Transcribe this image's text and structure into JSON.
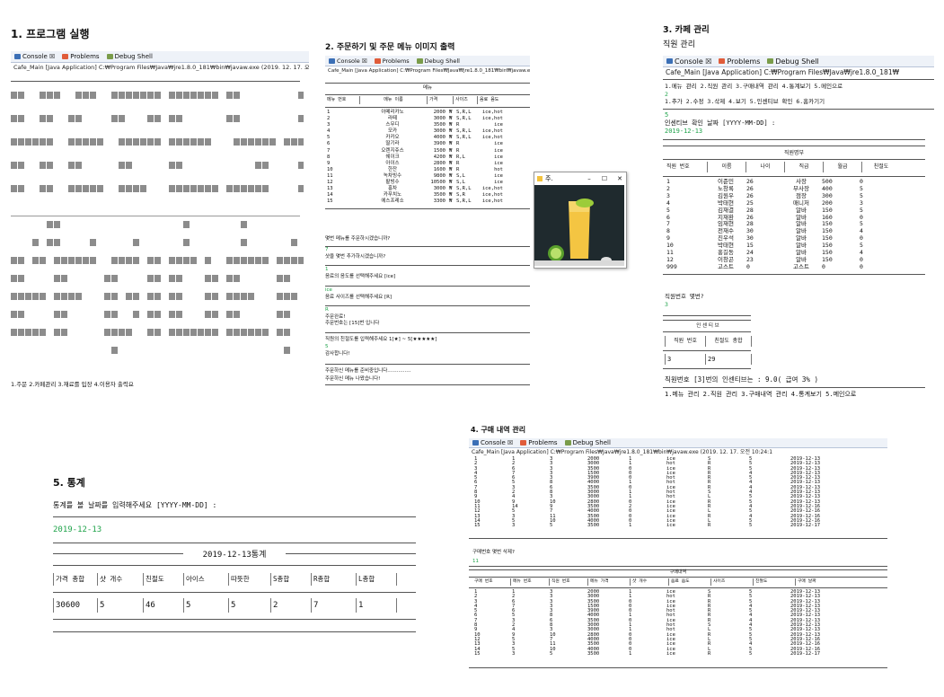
{
  "sec1": {
    "title": "1. 프로그램 실행",
    "tabs": [
      "Console ☒",
      "Problems",
      "Debug Shell"
    ],
    "cmdline": "Cafe_Main [Java Application] C:₩Program Files₩Java₩jre1.8.0_181₩bin₩javaw.exe (2019. 12. 17. 오전 10:24:11)",
    "menu": "1.주문 2.카페관리 3.재료를 입장 4.이용자 출력요"
  },
  "sec2": {
    "title": "2. 주문하기 및 주문 메뉴 이미지 출력",
    "tabs": [
      "Console ☒",
      "Problems",
      "Debug Shell"
    ],
    "cmdline": "Cafe_Main [Java Application] C:₩Program Files₩Java₩jre1.8.0_181₩bin₩javaw.exe (2019. 12. 17. 오전 10:24:11)",
    "menu_title": "메뉴",
    "headers": [
      "메뉴 번호",
      "메뉴 이름",
      "가격",
      "사이즈",
      "음료 음도"
    ],
    "rows": [
      [
        "1",
        "아메리카노",
        "2000",
        "₩",
        "S,R,L",
        "ice,hot"
      ],
      [
        "2",
        "라떼",
        "3000",
        "₩",
        "S,R,L",
        "ice,hot"
      ],
      [
        "3",
        "스무디",
        "3500",
        "₩",
        "R",
        "ice"
      ],
      [
        "4",
        "모카",
        "3000",
        "₩",
        "S,R,L",
        "ice,hot"
      ],
      [
        "5",
        "카카오",
        "4000",
        "₩",
        "S,R,L",
        "ice,hot"
      ],
      [
        "6",
        "딸기라",
        "3900",
        "₩",
        "R",
        "ice"
      ],
      [
        "7",
        "오렌지쥬스",
        "1500",
        "₩",
        "R",
        "ice"
      ],
      [
        "8",
        "쉐이크",
        "4200",
        "₩",
        "R,L",
        "ice"
      ],
      [
        "9",
        "아이스",
        "2800",
        "₩",
        "R",
        "ice"
      ],
      [
        "10",
        "한잔",
        "1600",
        "₩",
        "R",
        "hot"
      ],
      [
        "11",
        "녹차빙수",
        "9800",
        "₩",
        "S,L",
        "ice"
      ],
      [
        "12",
        "팥빙수",
        "10500",
        "₩",
        "S,L",
        "ice"
      ],
      [
        "13",
        "홍차",
        "3000",
        "₩",
        "S,R,L",
        "ice,hot"
      ],
      [
        "14",
        "카푸치노",
        "3500",
        "₩",
        "S,R",
        "ice,hot"
      ],
      [
        "15",
        "에스프레소",
        "3300",
        "₩",
        "S,R,L",
        "ice,hot"
      ]
    ],
    "q1": "몇번 메뉴를 주문하시겠습니까?",
    "a1": "7",
    "q2": "샷을 몇번 추가하시겠습니까?",
    "a2": "1",
    "q3": "음료의 음도를 선택해주세요 [ice]",
    "a3": "ice",
    "q4": "음료 사이즈를 선택해주세요 [R]",
    "a4": "R",
    "r1": "주문완료!",
    "r2": "주문번호는 [15]번 입니다",
    "q5": "직원의 친절도를 입력해주세요 1[★] ~ 5[★★★★★]",
    "a5": "5",
    "r3": "감사합니다!",
    "r4": "주문하신 메뉴를 준비중입니다...............",
    "r5": "주문하신 메뉴 나왔습니다!",
    "popup_title": "주.",
    "popup_min": "–",
    "popup_max": "☐",
    "popup_close": "✕"
  },
  "sec3": {
    "title": "3. 카페 관리",
    "subtitle": "직원 관리",
    "tabs": [
      "Console ☒",
      "Problems",
      "Debug Shell"
    ],
    "cmdline": "Cafe_Main [Java Application] C:₩Program Files₩Java₩jre1.8.0_181₩",
    "menu1": "1.메뉴 관리 2.직원 관리 3.구매내역 관리 4.통계보기 5.메인으로",
    "in1": "2",
    "menu2": "1.추가 2.수정 3.삭제 4.보기 5.인센티브 확인 6.홈카기기",
    "in2": "5",
    "ask_date": "인센티브 확인 날짜 [YYYY-MM-DD] :",
    "in_date": "2019-12-13",
    "list_title": "직원명부",
    "headers": [
      "직원 번호",
      "이름",
      "나이",
      "직급",
      "월급",
      "친절도"
    ],
    "rows": [
      [
        "1",
        "이준민",
        "26",
        "사장",
        "500",
        "0"
      ],
      [
        "2",
        "노창록",
        "26",
        "부사장",
        "400",
        "5"
      ],
      [
        "3",
        "김원우",
        "26",
        "점장",
        "300",
        "5"
      ],
      [
        "4",
        "박태현",
        "25",
        "매니저",
        "200",
        "3"
      ],
      [
        "5",
        "김재결",
        "28",
        "알바",
        "150",
        "5"
      ],
      [
        "6",
        "지재환",
        "26",
        "알바",
        "160",
        "0"
      ],
      [
        "7",
        "임재현",
        "28",
        "알바",
        "150",
        "5"
      ],
      [
        "8",
        "전재수",
        "30",
        "알바",
        "150",
        "4"
      ],
      [
        "9",
        "진우석",
        "30",
        "알바",
        "150",
        "0"
      ],
      [
        "10",
        "박태현",
        "15",
        "알바",
        "150",
        "5"
      ],
      [
        "11",
        "홍길동",
        "24",
        "알바",
        "150",
        "4"
      ],
      [
        "12",
        "이창곤",
        "23",
        "알바",
        "150",
        "0"
      ],
      [
        "999",
        "고스트",
        "0",
        "고스트",
        "0",
        "0"
      ]
    ],
    "ask_no": "직원번호 몇번?",
    "in_no": "3",
    "inc_title": "인 센 티 브",
    "inc_headers": [
      "직원 번호",
      "친절도 총합"
    ],
    "inc_row": [
      "3",
      "29"
    ],
    "result": "직원번호 [3]번의 인센티브는 : 9.0( 급여 3% )",
    "menu3": "1.메뉴 관리 2.직원 관리 3.구매내역 관리 4.통계보기 5.메인으로"
  },
  "sec4": {
    "title": "4. 구매 내역 관리",
    "tabs": [
      "Console ☒",
      "Problems",
      "Debug Shell"
    ],
    "cmdline": "Cafe_Main [Java Application] C:₩Program Files₩Java₩jre1.8.0_181₩bin₩javaw.exe (2019. 12. 17. 오전 10:24:1",
    "rows1": [
      [
        "1",
        "1",
        "3",
        "2000",
        "1",
        "ice",
        "S",
        "5",
        "2019-12-13"
      ],
      [
        "2",
        "2",
        "3",
        "3000",
        "1",
        "hot",
        "R",
        "5",
        "2019-12-13"
      ],
      [
        "3",
        "6",
        "3",
        "3500",
        "0",
        "ice",
        "R",
        "5",
        "2019-12-13"
      ],
      [
        "4",
        "7",
        "3",
        "1500",
        "0",
        "ice",
        "R",
        "4",
        "2019-12-13"
      ],
      [
        "5",
        "6",
        "3",
        "3900",
        "0",
        "hot",
        "R",
        "5",
        "2019-12-13"
      ],
      [
        "6",
        "5",
        "8",
        "4000",
        "1",
        "hot",
        "R",
        "4",
        "2019-12-13"
      ],
      [
        "7",
        "3",
        "6",
        "3500",
        "0",
        "ice",
        "R",
        "4",
        "2019-12-13"
      ],
      [
        "8",
        "2",
        "8",
        "3000",
        "1",
        "hot",
        "S",
        "4",
        "2019-12-13"
      ],
      [
        "9",
        "4",
        "3",
        "3000",
        "1",
        "hot",
        "L",
        "5",
        "2019-12-13"
      ],
      [
        "10",
        "9",
        "10",
        "2800",
        "0",
        "ice",
        "R",
        "5",
        "2019-12-13"
      ],
      [
        "11",
        "14",
        "9",
        "3500",
        "2",
        "ice",
        "R",
        "4",
        "2019-12-16"
      ],
      [
        "12",
        "5",
        "7",
        "4000",
        "0",
        "ice",
        "L",
        "5",
        "2019-12-16"
      ],
      [
        "13",
        "3",
        "11",
        "3500",
        "0",
        "ice",
        "R",
        "4",
        "2019-12-16"
      ],
      [
        "14",
        "5",
        "10",
        "4000",
        "0",
        "ice",
        "L",
        "5",
        "2019-12-16"
      ],
      [
        "15",
        "3",
        "5",
        "3500",
        "1",
        "ice",
        "R",
        "5",
        "2019-12-17"
      ]
    ],
    "ask_del": "구매번호 몇번 삭제?",
    "in_del": "11",
    "list_title": "구매내역",
    "headers": [
      "구매 번호",
      "메뉴 번호",
      "직원 번호",
      "메뉴 가격",
      "샷 개수",
      "음료 음도",
      "사이즈",
      "친절도",
      "구매 날짜"
    ],
    "rows2": [
      [
        "1",
        "1",
        "3",
        "2000",
        "1",
        "ice",
        "S",
        "5",
        "2019-12-13"
      ],
      [
        "2",
        "2",
        "3",
        "3000",
        "1",
        "hot",
        "R",
        "5",
        "2019-12-13"
      ],
      [
        "3",
        "6",
        "3",
        "3500",
        "0",
        "ice",
        "R",
        "5",
        "2019-12-13"
      ],
      [
        "4",
        "7",
        "3",
        "1500",
        "0",
        "ice",
        "R",
        "4",
        "2019-12-13"
      ],
      [
        "5",
        "6",
        "3",
        "3900",
        "0",
        "hot",
        "R",
        "5",
        "2019-12-13"
      ],
      [
        "6",
        "5",
        "8",
        "4000",
        "1",
        "hot",
        "R",
        "4",
        "2019-12-13"
      ],
      [
        "7",
        "3",
        "6",
        "3500",
        "0",
        "ice",
        "R",
        "4",
        "2019-12-13"
      ],
      [
        "8",
        "2",
        "8",
        "3000",
        "1",
        "hot",
        "S",
        "4",
        "2019-12-13"
      ],
      [
        "9",
        "4",
        "3",
        "3000",
        "1",
        "hot",
        "L",
        "5",
        "2019-12-13"
      ],
      [
        "10",
        "9",
        "10",
        "2800",
        "0",
        "ice",
        "R",
        "5",
        "2019-12-13"
      ],
      [
        "12",
        "5",
        "7",
        "4000",
        "0",
        "ice",
        "L",
        "5",
        "2019-12-16"
      ],
      [
        "13",
        "3",
        "11",
        "3500",
        "0",
        "ice",
        "R",
        "4",
        "2019-12-16"
      ],
      [
        "14",
        "5",
        "10",
        "4000",
        "0",
        "ice",
        "L",
        "5",
        "2019-12-16"
      ],
      [
        "15",
        "3",
        "5",
        "3500",
        "1",
        "ice",
        "R",
        "5",
        "2019-12-17"
      ]
    ]
  },
  "sec5": {
    "title": "5. 통계",
    "ask": "통계를 볼 날짜를 입력해주세요 [YYYY-MM-DD] :",
    "input": "2019-12-13",
    "stat_title": "2019-12-13통계",
    "headers": [
      "가격 총합",
      "샷 개수",
      "친절도",
      "아이스",
      "따뜻한",
      "S총합",
      "R총합",
      "L총합"
    ],
    "values": [
      "30600",
      "5",
      "46",
      "5",
      "5",
      "2",
      "7",
      "1"
    ]
  },
  "colors": {
    "green": "#1fa34a",
    "tab_bg": "#eef2f8"
  }
}
